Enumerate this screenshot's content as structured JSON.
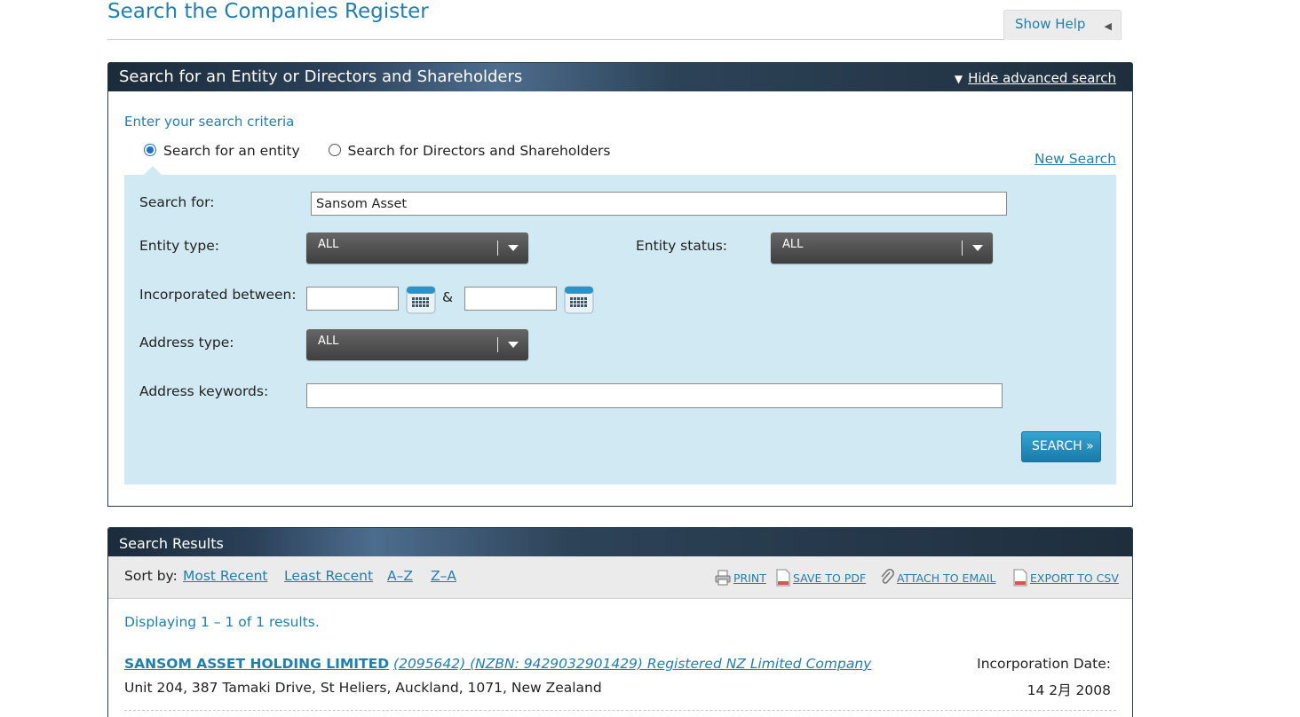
{
  "page": {
    "title": "Search the Companies Register",
    "show_help": "Show Help"
  },
  "search_panel": {
    "heading": "Search for an Entity or Directors and Shareholders",
    "advanced_link": "Hide advanced search",
    "criteria_label": "Enter your search criteria",
    "radio_entity": "Search for an entity",
    "radio_directors": "Search for Directors and Shareholders",
    "selected_radio": "entity",
    "new_search": "New Search",
    "search_for_label": "Search for:",
    "search_for_value": "Sansom Asset",
    "entity_type_label": "Entity type:",
    "entity_type_value": "ALL",
    "entity_status_label": "Entity status:",
    "entity_status_value": "ALL",
    "incorporated_label": "Incorporated between:",
    "incorporated_from": "",
    "incorporated_to": "",
    "ampersand": "&",
    "address_type_label": "Address type:",
    "address_type_value": "ALL",
    "address_keywords_label": "Address keywords:",
    "address_keywords_value": "",
    "search_button": "SEARCH »"
  },
  "results": {
    "heading": "Search Results",
    "sort_label": "Sort by:",
    "sort_options": [
      "Most Recent",
      "Least Recent",
      "A–Z",
      "Z–A"
    ],
    "tools": {
      "print": "PRINT",
      "save_pdf": "SAVE TO PDF",
      "attach_email": "ATTACH TO EMAIL",
      "export_csv": "EXPORT TO CSV"
    },
    "displaying": "Displaying 1 – 1 of 1 results.",
    "items": [
      {
        "name": "SANSOM ASSET HOLDING LIMITED",
        "meta": "(2095642) (NZBN: 9429032901429) Registered NZ Limited Company",
        "address": "Unit 204, 387 Tamaki Drive, St Heliers, Auckland, 1071, New Zealand",
        "incorporation_label": "Incorporation Date:",
        "incorporation_date": "14 2月 2008"
      }
    ]
  },
  "colors": {
    "link_blue": "#1f7fae",
    "panel_bg": "#d1e9f2",
    "header_dark": "#1b2b3a",
    "button_blue": "#1a7aab"
  }
}
